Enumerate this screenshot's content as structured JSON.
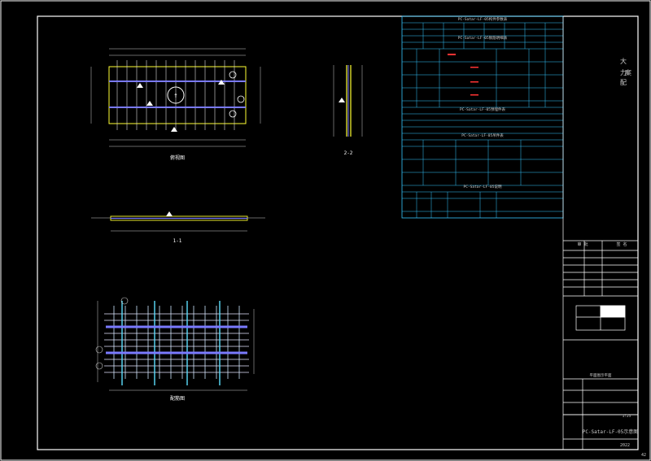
{
  "drawing": {
    "title_block": {
      "side_chars": [
        "大",
        "力",
        "案",
        "配"
      ],
      "header_cols": [
        "审 批",
        "签 名"
      ],
      "block_label": "平面图示平面",
      "drawing_name": "PC-Satar-LF-05示意图",
      "sheet_no": "2022",
      "scale": "1:25",
      "page_no": "42"
    },
    "views": {
      "plan_label": "俯视图",
      "section_1_label": "1-1",
      "section_2_label": "2-2",
      "rebar_label": "配筋图"
    },
    "tables": {
      "main_title": "PC-Satar-LF-05构件参数表",
      "rebar_title": "PC-Satar-LF-05钢筋明细表",
      "embed_title": "PC-Satar-LF-05预埋件表",
      "lift_title": "PC-Satar-LF-05吊件表",
      "note_title": "PC-Satar-LF-05说明"
    }
  }
}
